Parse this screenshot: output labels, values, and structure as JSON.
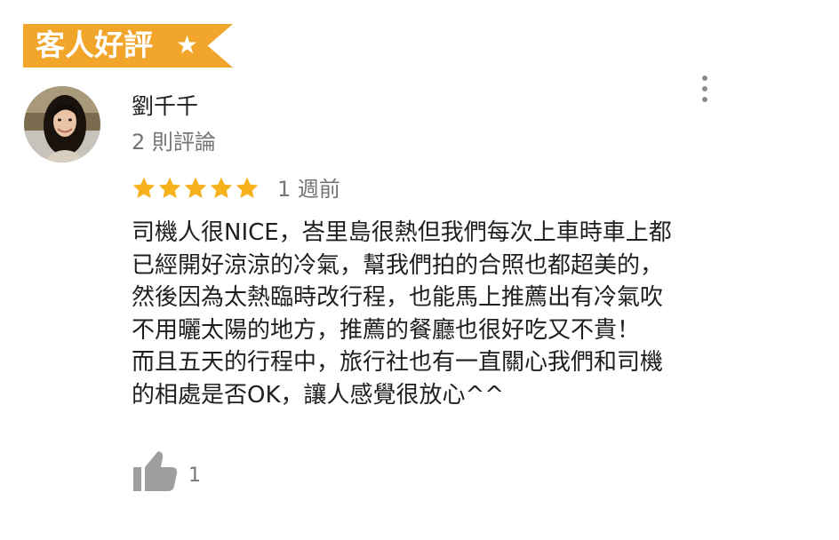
{
  "banner": {
    "title": "客人好評",
    "icon": "star-icon",
    "color": "#f1a52b"
  },
  "review": {
    "author_name": "劉千千",
    "review_count": "2 則評論",
    "rating": 5,
    "rating_max": 5,
    "time": "1 週前",
    "lines": [
      "司機人很NICE，峇里島很熱但我們每次上車時車上都",
      "已經開好涼涼的冷氣，幫我們拍的合照也都超美的，",
      "然後因為太熱臨時改行程，也能馬上推薦出有冷氣吹",
      "不用曬太陽的地方，推薦的餐廳也很好吃又不貴！",
      "而且五天的行程中，旅行社也有一直關心我們和司機",
      "的相處是否OK，讓人感覺很放心^^"
    ],
    "like_count": "1",
    "star_color": "#f5b21c"
  },
  "icons": {
    "more": "more-vert-icon",
    "like": "thumbs-up-icon"
  }
}
